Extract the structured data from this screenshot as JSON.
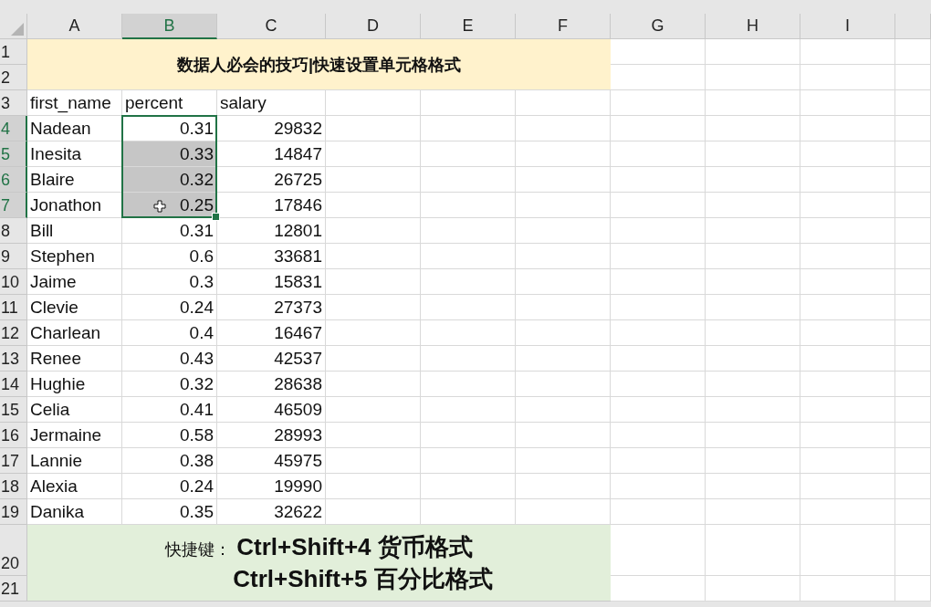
{
  "columns": [
    {
      "label": "A",
      "selected": false
    },
    {
      "label": "B",
      "selected": true
    },
    {
      "label": "C",
      "selected": false
    },
    {
      "label": "D",
      "selected": false
    },
    {
      "label": "E",
      "selected": false
    },
    {
      "label": "F",
      "selected": false
    },
    {
      "label": "G",
      "selected": false
    },
    {
      "label": "H",
      "selected": false
    },
    {
      "label": "I",
      "selected": false
    }
  ],
  "title_rows": [
    "1",
    "2"
  ],
  "title": "数据人必会的技巧|快速设置单元格格式",
  "header_row": {
    "row": "3",
    "cells": [
      "first_name",
      "percent",
      "salary"
    ]
  },
  "rows": [
    {
      "row": "4",
      "first_name": "Nadean",
      "percent": "0.31",
      "salary": "29832",
      "selected": true
    },
    {
      "row": "5",
      "first_name": "Inesita",
      "percent": "0.33",
      "salary": "14847",
      "selected": true
    },
    {
      "row": "6",
      "first_name": "Blaire",
      "percent": "0.32",
      "salary": "26725",
      "selected": true
    },
    {
      "row": "7",
      "first_name": "Jonathon",
      "percent": "0.25",
      "salary": "17846",
      "selected": true
    },
    {
      "row": "8",
      "first_name": "Bill",
      "percent": "0.31",
      "salary": "12801",
      "selected": false
    },
    {
      "row": "9",
      "first_name": "Stephen",
      "percent": "0.6",
      "salary": "33681",
      "selected": false
    },
    {
      "row": "10",
      "first_name": "Jaime",
      "percent": "0.3",
      "salary": "15831",
      "selected": false
    },
    {
      "row": "11",
      "first_name": "Clevie",
      "percent": "0.24",
      "salary": "27373",
      "selected": false
    },
    {
      "row": "12",
      "first_name": "Charlean",
      "percent": "0.4",
      "salary": "16467",
      "selected": false
    },
    {
      "row": "13",
      "first_name": "Renee",
      "percent": "0.43",
      "salary": "42537",
      "selected": false
    },
    {
      "row": "14",
      "first_name": "Hughie",
      "percent": "0.32",
      "salary": "28638",
      "selected": false
    },
    {
      "row": "15",
      "first_name": "Celia",
      "percent": "0.41",
      "salary": "46509",
      "selected": false
    },
    {
      "row": "16",
      "first_name": "Jermaine",
      "percent": "0.58",
      "salary": "28993",
      "selected": false
    },
    {
      "row": "17",
      "first_name": "Lannie",
      "percent": "0.38",
      "salary": "45975",
      "selected": false
    },
    {
      "row": "18",
      "first_name": "Alexia",
      "percent": "0.24",
      "salary": "19990",
      "selected": false
    },
    {
      "row": "19",
      "first_name": "Danika",
      "percent": "0.35",
      "salary": "32622",
      "selected": false
    }
  ],
  "footer_rows": [
    "20",
    "21"
  ],
  "footer": {
    "label": "快捷键：",
    "lines": [
      "Ctrl+Shift+4 货币格式",
      "Ctrl+Shift+5 百分比格式"
    ]
  }
}
